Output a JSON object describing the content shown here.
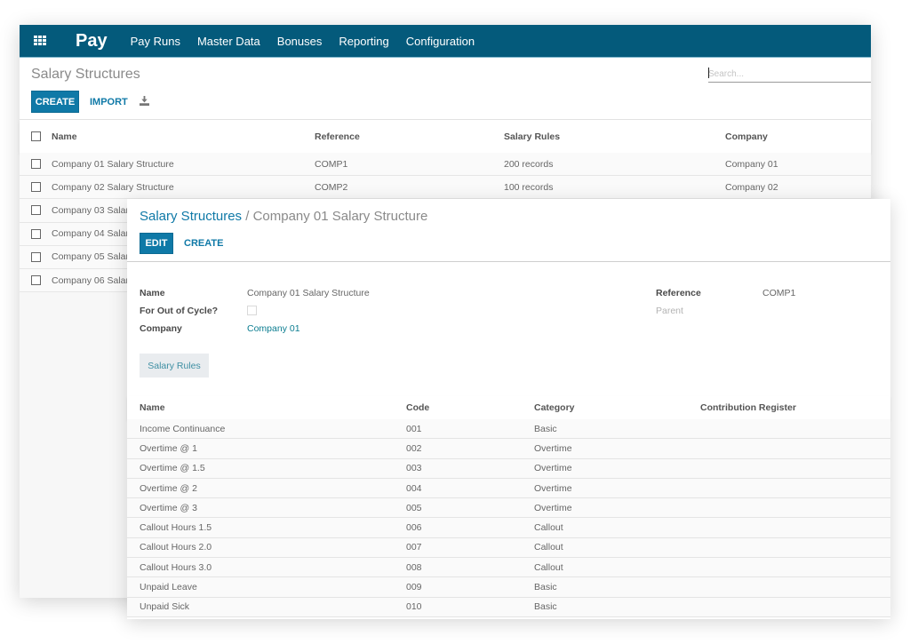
{
  "app": {
    "brand": "Pay",
    "menu": [
      "Pay Runs",
      "Master Data",
      "Bonuses",
      "Reporting",
      "Configuration"
    ]
  },
  "list_view": {
    "title": "Salary Structures",
    "search_placeholder": "Search...",
    "create_label": "CREATE",
    "import_label": "IMPORT",
    "download_icon": "download-icon",
    "columns": [
      "Name",
      "Reference",
      "Salary Rules",
      "Company"
    ],
    "rows": [
      {
        "name": "Company 01 Salary Structure",
        "reference": "COMP1",
        "salary_rules": "200 records",
        "company": "Company 01"
      },
      {
        "name": "Company 02 Salary Structure",
        "reference": "COMP2",
        "salary_rules": "100 records",
        "company": "Company 02"
      },
      {
        "name": "Company 03 Salar",
        "reference": "",
        "salary_rules": "",
        "company": ""
      },
      {
        "name": "Company 04 Salar",
        "reference": "",
        "salary_rules": "",
        "company": ""
      },
      {
        "name": "Company 05 Salar",
        "reference": "",
        "salary_rules": "",
        "company": ""
      },
      {
        "name": "Company 06 Salar",
        "reference": "",
        "salary_rules": "",
        "company": ""
      }
    ]
  },
  "form_view": {
    "breadcrumb_parent": "Salary Structures",
    "breadcrumb_sep": " / ",
    "breadcrumb_current": "Company 01 Salary Structure",
    "edit_label": "EDIT",
    "create_label": "CREATE",
    "fields": {
      "name_label": "Name",
      "name_value": "Company 01 Salary Structure",
      "out_of_cycle_label": "For Out of Cycle?",
      "out_of_cycle_checked": false,
      "company_label": "Company",
      "company_value": "Company 01",
      "reference_label": "Reference",
      "reference_value": "COMP1",
      "parent_label": "Parent",
      "parent_value": ""
    },
    "tab_label": "Salary Rules",
    "rules_columns": [
      "Name",
      "Code",
      "Category",
      "Contribution Register"
    ],
    "rules": [
      {
        "name": "Income Continuance",
        "code": "001",
        "category": "Basic",
        "register": ""
      },
      {
        "name": "Overtime @ 1",
        "code": "002",
        "category": "Overtime",
        "register": ""
      },
      {
        "name": "Overtime @ 1.5",
        "code": "003",
        "category": "Overtime",
        "register": ""
      },
      {
        "name": "Overtime @ 2",
        "code": "004",
        "category": "Overtime",
        "register": ""
      },
      {
        "name": "Overtime @ 3",
        "code": "005",
        "category": "Overtime",
        "register": ""
      },
      {
        "name": "Callout Hours 1.5",
        "code": "006",
        "category": "Callout",
        "register": ""
      },
      {
        "name": "Callout Hours 2.0",
        "code": "007",
        "category": "Callout",
        "register": ""
      },
      {
        "name": "Callout Hours 3.0",
        "code": "008",
        "category": "Callout",
        "register": ""
      },
      {
        "name": "Unpaid Leave",
        "code": "009",
        "category": "Basic",
        "register": ""
      },
      {
        "name": "Unpaid Sick",
        "code": "010",
        "category": "Basic",
        "register": ""
      }
    ]
  },
  "colors": {
    "navbar": "#045a7b",
    "primary": "#0f79a7",
    "link": "#0b7d90"
  }
}
